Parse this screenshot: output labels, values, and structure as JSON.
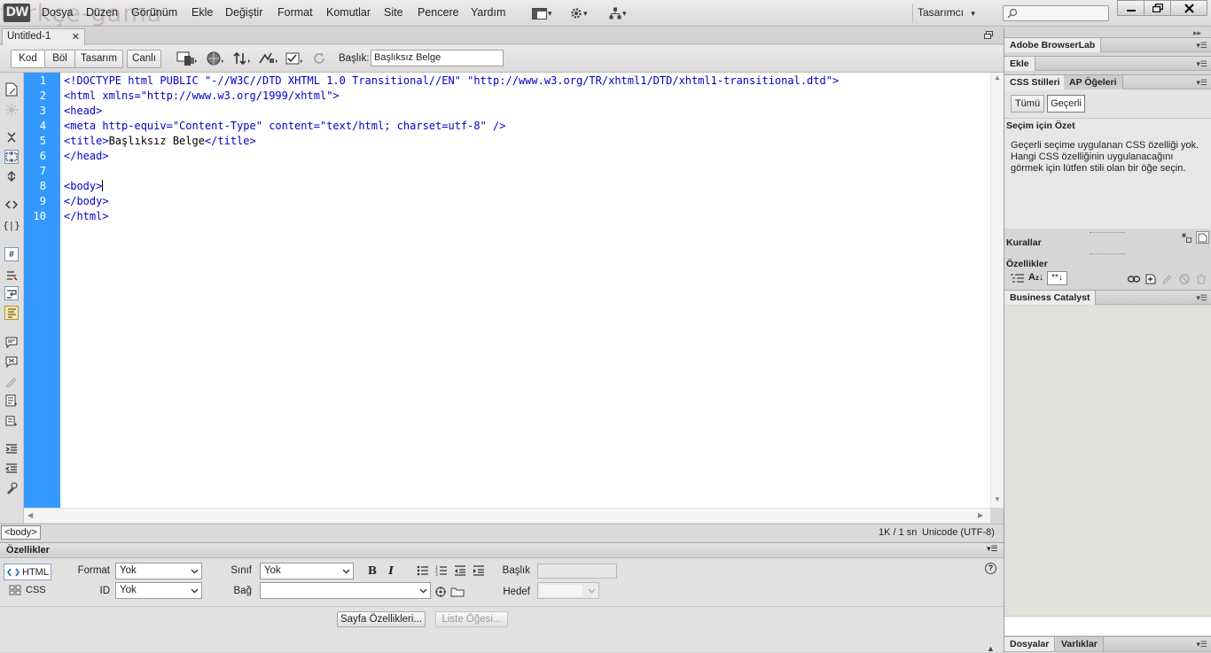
{
  "app": {
    "logo": "DW",
    "watermark": "türkçe-gama"
  },
  "menu": {
    "items": [
      "Dosya",
      "Düzen",
      "Görünüm",
      "Ekle",
      "Değiştir",
      "Format",
      "Komutlar",
      "Site",
      "Pencere",
      "Yardım"
    ],
    "workspace": "Tasarımcı"
  },
  "document": {
    "tab": "Untitled-1",
    "views": [
      "Kod",
      "Böl",
      "Tasarım",
      "Canlı"
    ],
    "active_view": "Kod",
    "title_label": "Başlık:",
    "title_value": "Başlıksız Belge"
  },
  "code": {
    "line_numbers": [
      "1",
      "2",
      "3",
      "4",
      "5",
      "6",
      "7",
      "8",
      "9",
      "10"
    ],
    "lines": [
      "<!DOCTYPE html PUBLIC \"-//W3C//DTD XHTML 1.0 Transitional//EN\" \"http://www.w3.org/TR/xhtml1/DTD/xhtml1-transitional.dtd\">",
      "<html xmlns=\"http://www.w3.org/1999/xhtml\">",
      "<head>",
      "<meta http-equiv=\"Content-Type\" content=\"text/html; charset=utf-8\" />",
      "<title>",
      "Başlıksız Belge",
      "</title>",
      "</head>",
      "<body>",
      "</body>",
      "</html>"
    ]
  },
  "status": {
    "tag_selector": "<body>",
    "size_time": "1K / 1 sn",
    "encoding": "Unicode (UTF-8)"
  },
  "properties": {
    "title": "Özellikler",
    "html_tab": "HTML",
    "css_tab": "CSS",
    "format_label": "Format",
    "format_value": "Yok",
    "id_label": "ID",
    "id_value": "Yok",
    "class_label": "Sınıf",
    "class_value": "Yok",
    "link_label": "Bağ",
    "link_value": "",
    "title_label": "Başlık",
    "target_label": "Hedef",
    "page_props_button": "Sayfa Özellikleri...",
    "list_item_button": "Liste Öğesi..."
  },
  "panels": {
    "browserlab": "Adobe BrowserLab",
    "insert": "Ekle",
    "css_styles_tab": "CSS Stilleri",
    "ap_elements_tab": "AP Öğeleri",
    "all_button": "Tümü",
    "current_button": "Geçerli",
    "summary_title": "Seçim için Özet",
    "summary_text": "Geçerli seçime uygulanan CSS özelliği yok. Hangi CSS özelliğinin uygulanacağını görmek için lütfen stili olan bir öğe seçin.",
    "rules_title": "Kurallar",
    "properties_title": "Özellikler",
    "business_catalyst": "Business Catalyst",
    "files_tab": "Dosyalar",
    "assets_tab": "Varlıklar"
  },
  "colors": {
    "gutter": "#3399ff",
    "code_tag": "#0000cc"
  }
}
